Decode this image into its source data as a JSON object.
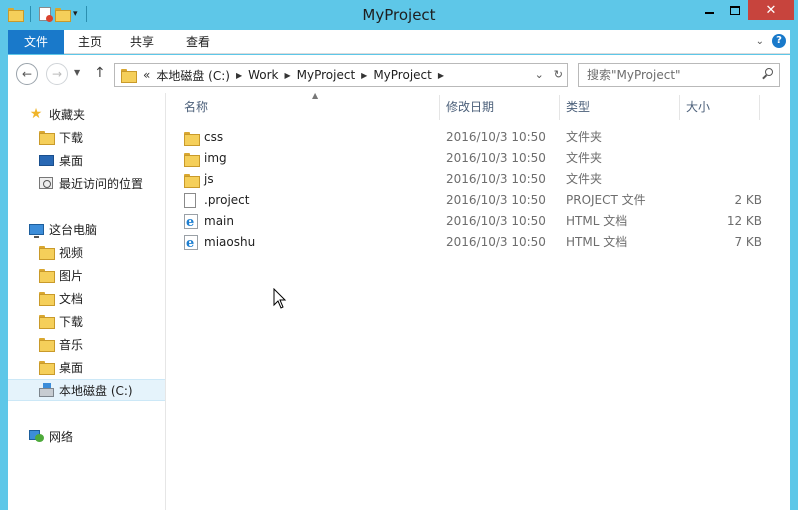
{
  "window": {
    "title": "MyProject"
  },
  "ribbon": {
    "tabs": [
      "文件",
      "主页",
      "共享",
      "查看"
    ]
  },
  "address": {
    "overflow": "«",
    "path": [
      "本地磁盘 (C:)",
      "Work",
      "MyProject",
      "MyProject"
    ]
  },
  "search": {
    "placeholder": "搜索\"MyProject\""
  },
  "nav_pane": {
    "favorites_label": "收藏夹",
    "favorites": [
      "下载",
      "桌面",
      "最近访问的位置"
    ],
    "this_pc_label": "这台电脑",
    "this_pc": [
      "视频",
      "图片",
      "文档",
      "下载",
      "音乐",
      "桌面"
    ],
    "drive_label": "本地磁盘 (C:)",
    "network_label": "网络"
  },
  "file_list": {
    "columns": [
      "名称",
      "修改日期",
      "类型",
      "大小"
    ],
    "rows": [
      {
        "icon": "folder-icon",
        "name": "css",
        "date": "2016/10/3 10:50",
        "type": "文件夹",
        "size": ""
      },
      {
        "icon": "folder-icon",
        "name": "img",
        "date": "2016/10/3 10:50",
        "type": "文件夹",
        "size": ""
      },
      {
        "icon": "folder-icon",
        "name": "js",
        "date": "2016/10/3 10:50",
        "type": "文件夹",
        "size": ""
      },
      {
        "icon": "file-icon",
        "name": ".project",
        "date": "2016/10/3 10:50",
        "type": "PROJECT 文件",
        "size": "2 KB"
      },
      {
        "icon": "html-file-icon",
        "name": "main",
        "date": "2016/10/3 10:50",
        "type": "HTML 文档",
        "size": "12 KB"
      },
      {
        "icon": "html-file-icon",
        "name": "miaoshu",
        "date": "2016/10/3 10:50",
        "type": "HTML 文档",
        "size": "7 KB"
      }
    ]
  },
  "colors": {
    "titlebar": "#5ec7e8",
    "file_tab": "#1979ca",
    "close_button": "#c7443d",
    "selection": "#e5f3fb"
  }
}
